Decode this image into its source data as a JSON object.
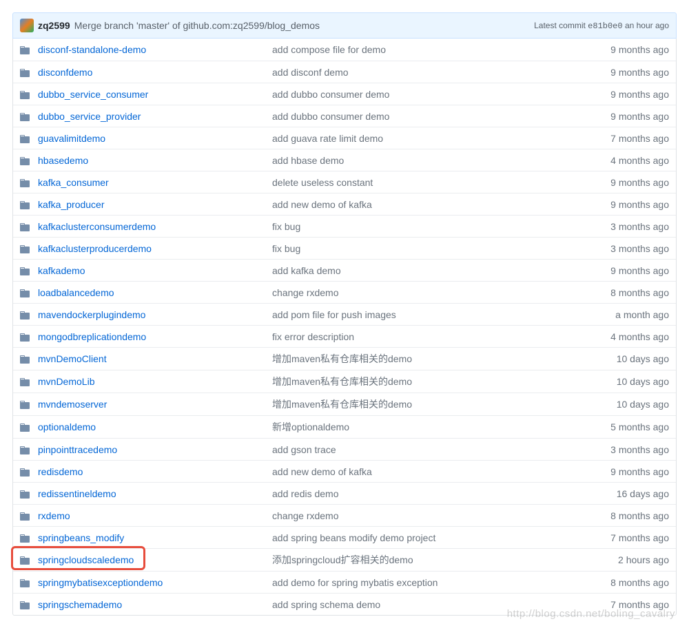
{
  "header": {
    "author": "zq2599",
    "message": "Merge branch 'master' of github.com:zq2599/blog_demos",
    "latest_commit_label": "Latest commit",
    "hash": "e81b0e0",
    "time": "an hour ago"
  },
  "files": [
    {
      "name": "disconf-standalone-demo",
      "message": "add compose file for demo",
      "age": "9 months ago"
    },
    {
      "name": "disconfdemo",
      "message": "add disconf demo",
      "age": "9 months ago"
    },
    {
      "name": "dubbo_service_consumer",
      "message": "add dubbo consumer demo",
      "age": "9 months ago"
    },
    {
      "name": "dubbo_service_provider",
      "message": "add dubbo consumer demo",
      "age": "9 months ago"
    },
    {
      "name": "guavalimitdemo",
      "message": "add guava rate limit demo",
      "age": "7 months ago"
    },
    {
      "name": "hbasedemo",
      "message": "add hbase demo",
      "age": "4 months ago"
    },
    {
      "name": "kafka_consumer",
      "message": "delete useless constant",
      "age": "9 months ago"
    },
    {
      "name": "kafka_producer",
      "message": "add new demo of kafka",
      "age": "9 months ago"
    },
    {
      "name": "kafkaclusterconsumerdemo",
      "message": "fix bug",
      "age": "3 months ago"
    },
    {
      "name": "kafkaclusterproducerdemo",
      "message": "fix bug",
      "age": "3 months ago"
    },
    {
      "name": "kafkademo",
      "message": "add kafka demo",
      "age": "9 months ago"
    },
    {
      "name": "loadbalancedemo",
      "message": "change rxdemo",
      "age": "8 months ago"
    },
    {
      "name": "mavendockerplugindemo",
      "message": "add pom file for push images",
      "age": "a month ago"
    },
    {
      "name": "mongodbreplicationdemo",
      "message": "fix error description",
      "age": "4 months ago"
    },
    {
      "name": "mvnDemoClient",
      "message": "增加maven私有仓库相关的demo",
      "age": "10 days ago"
    },
    {
      "name": "mvnDemoLib",
      "message": "增加maven私有仓库相关的demo",
      "age": "10 days ago"
    },
    {
      "name": "mvndemoserver",
      "message": "增加maven私有仓库相关的demo",
      "age": "10 days ago"
    },
    {
      "name": "optionaldemo",
      "message": "新增optionaldemo",
      "age": "5 months ago"
    },
    {
      "name": "pinpointtracedemo",
      "message": "add gson trace",
      "age": "3 months ago"
    },
    {
      "name": "redisdemo",
      "message": "add new demo of kafka",
      "age": "9 months ago"
    },
    {
      "name": "redissentineldemo",
      "message": "add redis demo",
      "age": "16 days ago"
    },
    {
      "name": "rxdemo",
      "message": "change rxdemo",
      "age": "8 months ago"
    },
    {
      "name": "springbeans_modify",
      "message": "add spring beans modify demo project",
      "age": "7 months ago"
    },
    {
      "name": "springcloudscaledemo",
      "message": "添加springcloud扩容相关的demo",
      "age": "2 hours ago",
      "highlighted": true
    },
    {
      "name": "springmybatisexceptiondemo",
      "message": "add demo for spring mybatis exception",
      "age": "8 months ago"
    },
    {
      "name": "springschemademo",
      "message": "add spring schema demo",
      "age": "7 months ago"
    }
  ],
  "watermark": "http://blog.csdn.net/boling_cavalry"
}
